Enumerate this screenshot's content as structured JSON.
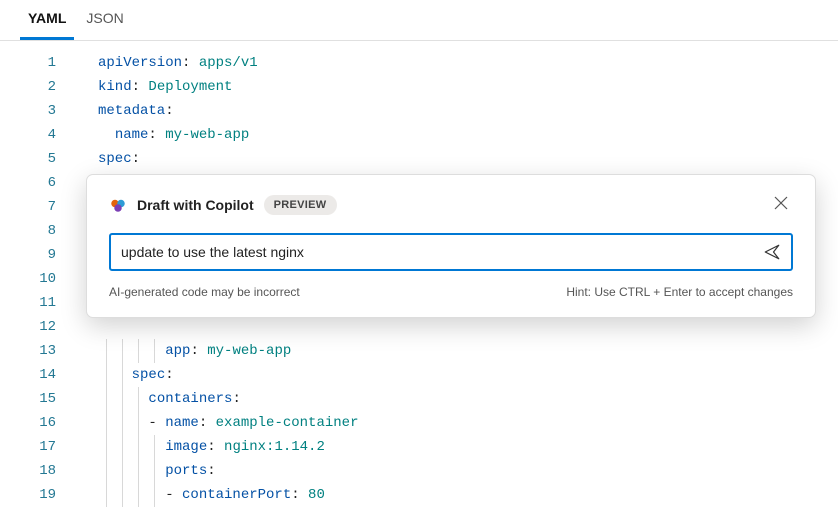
{
  "tabs": {
    "yaml": "YAML",
    "json": "JSON",
    "active": "yaml"
  },
  "lines": [
    {
      "n": 1,
      "indent": 0,
      "key": "apiVersion",
      "sep": ": ",
      "val": "apps/v1"
    },
    {
      "n": 2,
      "indent": 0,
      "key": "kind",
      "sep": ": ",
      "val": "Deployment"
    },
    {
      "n": 3,
      "indent": 0,
      "key": "metadata",
      "sep": ":"
    },
    {
      "n": 4,
      "indent": 1,
      "key": "name",
      "sep": ": ",
      "val": "my-web-app"
    },
    {
      "n": 5,
      "indent": 0,
      "key": "spec",
      "sep": ":"
    },
    {
      "n": 6,
      "blank": true
    },
    {
      "n": 7,
      "blank": true
    },
    {
      "n": 8,
      "blank": true
    },
    {
      "n": 9,
      "blank": true
    },
    {
      "n": 10,
      "blank": true
    },
    {
      "n": 11,
      "blank": true
    },
    {
      "n": 12,
      "blank": true
    },
    {
      "n": 13,
      "indent": 4,
      "key": "app",
      "sep": ": ",
      "val": "my-web-app"
    },
    {
      "n": 14,
      "indent": 2,
      "key": "spec",
      "sep": ":"
    },
    {
      "n": 15,
      "indent": 3,
      "key": "containers",
      "sep": ":"
    },
    {
      "n": 16,
      "indent": 3,
      "dash": true,
      "key": "name",
      "sep": ": ",
      "val": "example-container"
    },
    {
      "n": 17,
      "indent": 4,
      "key": "image",
      "sep": ": ",
      "val": "nginx:1.14.2"
    },
    {
      "n": 18,
      "indent": 4,
      "key": "ports",
      "sep": ":"
    },
    {
      "n": 19,
      "indent": 4,
      "dash": true,
      "key": "containerPort",
      "sep": ": ",
      "val": "80",
      "isNum": true
    }
  ],
  "popup": {
    "title": "Draft with Copilot",
    "badge": "PREVIEW",
    "input_value": "update to use the latest nginx",
    "disclaimer": "AI-generated code may be incorrect",
    "hint": "Hint: Use CTRL + Enter to accept changes"
  }
}
